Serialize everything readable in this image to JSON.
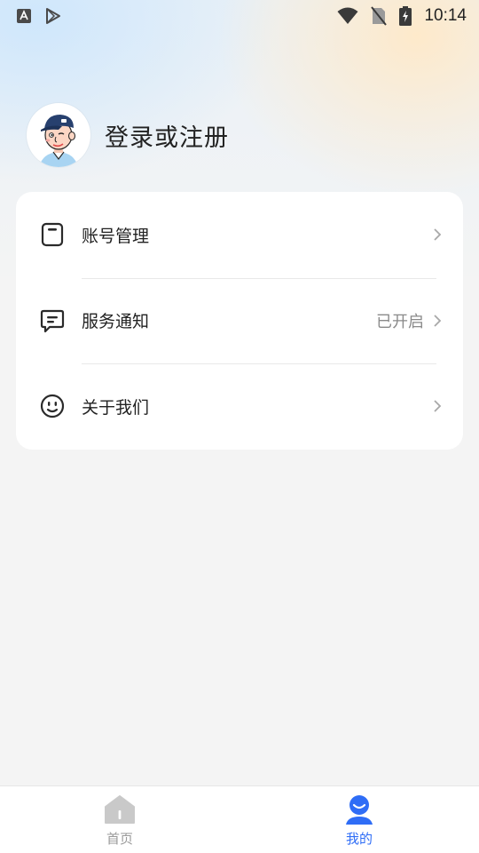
{
  "status_bar": {
    "time": "10:14",
    "left_icons": [
      "a-keyboard-icon",
      "play-store-icon"
    ],
    "right_icons": [
      "wifi-icon",
      "no-sim-icon",
      "battery-charging-icon"
    ]
  },
  "profile": {
    "login_text": "登录或注册",
    "avatar_icon": "avatar-cartoon-icon"
  },
  "menu": {
    "items": [
      {
        "label": "账号管理",
        "icon": "account-icon",
        "value": ""
      },
      {
        "label": "服务通知",
        "icon": "message-icon",
        "value": "已开启"
      },
      {
        "label": "关于我们",
        "icon": "smile-icon",
        "value": ""
      }
    ]
  },
  "bottom_nav": {
    "items": [
      {
        "label": "首页",
        "icon": "home-icon",
        "active": false
      },
      {
        "label": "我的",
        "icon": "person-icon",
        "active": true
      }
    ]
  },
  "colors": {
    "accent": "#2f6df6",
    "inactive": "#9a9a9a",
    "text": "#222222",
    "background": "#f4f4f4"
  }
}
